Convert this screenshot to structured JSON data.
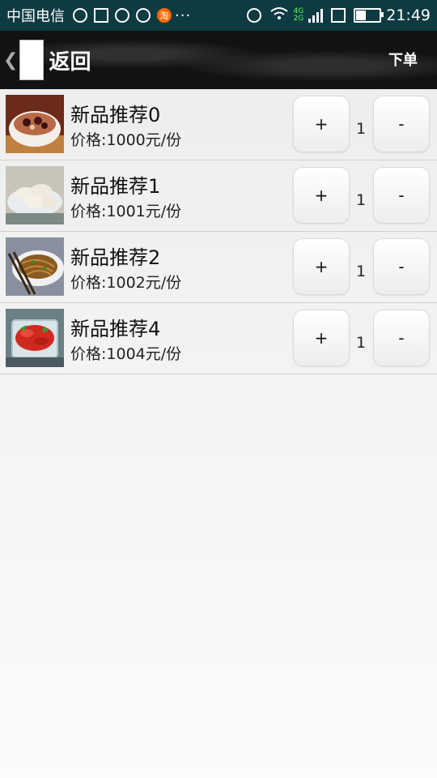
{
  "status_bar": {
    "carrier": "中国电信",
    "dots": "···",
    "network_top": "4G",
    "network_bottom": "2G",
    "time": "21:49",
    "taobao_glyph": "淘",
    "battery_level": 0.4
  },
  "header": {
    "back_label": "返回",
    "order_label": "下单"
  },
  "items": [
    {
      "name": "新品推荐0",
      "price": "价格:1000元/份",
      "quantity": "1",
      "plus": "+",
      "minus": "-",
      "image": "soup"
    },
    {
      "name": "新品推荐1",
      "price": "价格:1001元/份",
      "quantity": "1",
      "plus": "+",
      "minus": "-",
      "image": "dumplings"
    },
    {
      "name": "新品推荐2",
      "price": "价格:1002元/份",
      "quantity": "1",
      "plus": "+",
      "minus": "-",
      "image": "noodles"
    },
    {
      "name": "新品推荐4",
      "price": "价格:1004元/份",
      "quantity": "1",
      "plus": "+",
      "minus": "-",
      "image": "salad"
    }
  ]
}
